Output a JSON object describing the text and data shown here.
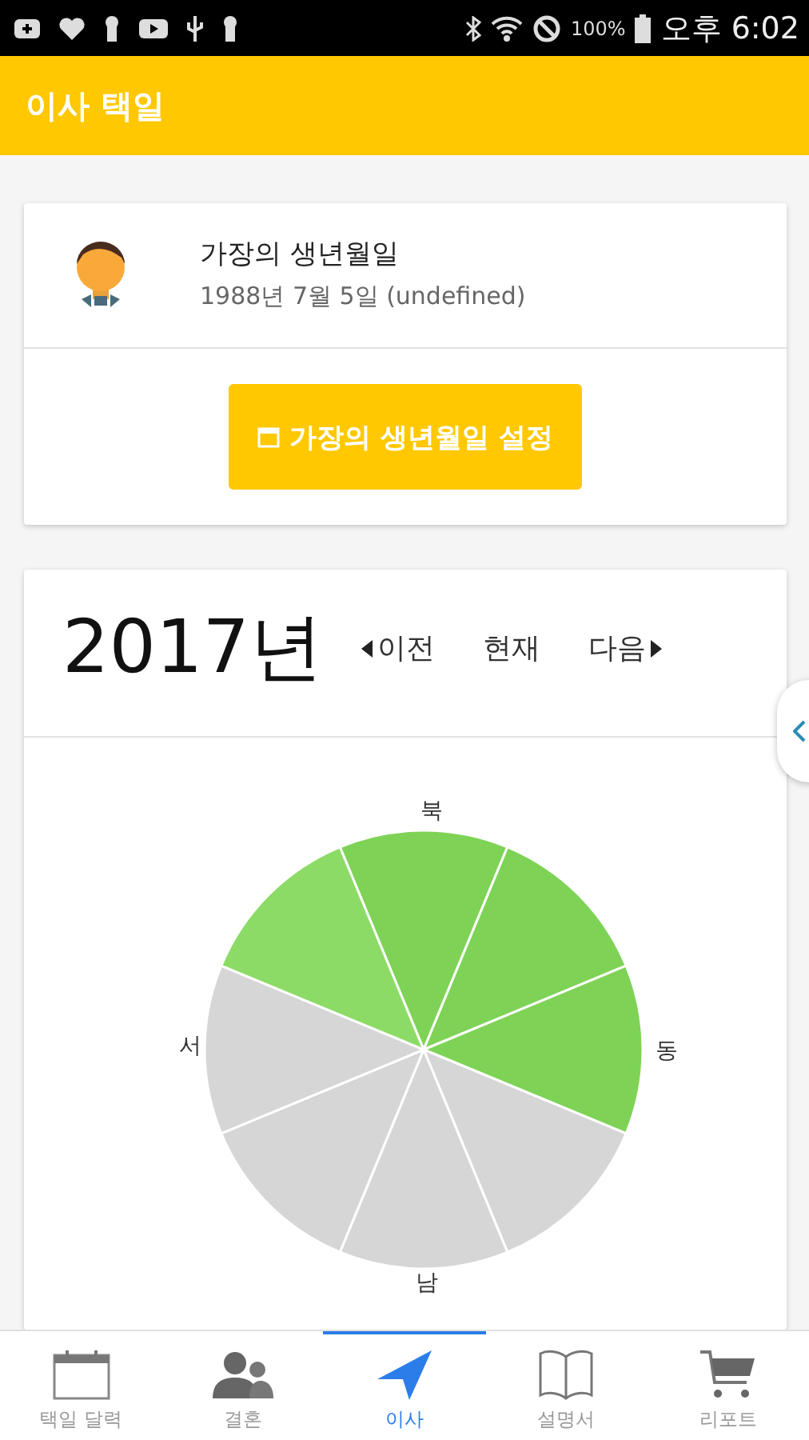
{
  "status_bar": {
    "battery": "100%",
    "time": "오후 6:02"
  },
  "app_bar": {
    "title": "이사 택일"
  },
  "profile": {
    "title": "가장의 생년월일",
    "subtitle": "1988년 7월 5일 (undefined)",
    "button": "가장의 생년월일 설정"
  },
  "year_panel": {
    "year": "2017년",
    "nav": [
      {
        "kind": "prev",
        "label": "이전"
      },
      {
        "kind": "now",
        "label": "현재"
      },
      {
        "kind": "next",
        "label": "다음"
      }
    ]
  },
  "compass": {
    "labels": [
      {
        "kind": "north",
        "label": "북"
      },
      {
        "kind": "east",
        "label": "동"
      },
      {
        "kind": "west",
        "label": "서"
      },
      {
        "kind": "south",
        "label": "남"
      }
    ],
    "sectors": [
      {
        "color": "#7ed356"
      },
      {
        "color": "#7ed356"
      },
      {
        "color": "#7ed356"
      },
      {
        "color": "#d6d6d6"
      },
      {
        "color": "#d6d6d6"
      },
      {
        "color": "#d6d6d6"
      },
      {
        "color": "#d6d6d6"
      },
      {
        "color": "#8cdb66"
      }
    ]
  },
  "tabs": [
    {
      "kind": "calendar",
      "label": "택일 달력",
      "selected": false
    },
    {
      "kind": "people",
      "label": "결혼",
      "selected": false
    },
    {
      "kind": "navigate",
      "label": "이사",
      "selected": true
    },
    {
      "kind": "book",
      "label": "설명서",
      "selected": false
    },
    {
      "kind": "cart",
      "label": "리포트",
      "selected": false
    }
  ]
}
